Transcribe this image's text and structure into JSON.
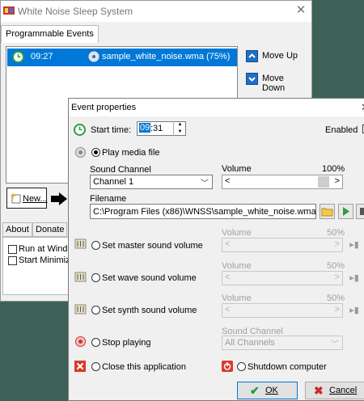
{
  "main": {
    "title": "White Noise Sleep System",
    "tab": "Programmable Events",
    "events": [
      {
        "time": "09:27",
        "description": "sample_white_noise.wma (75%)"
      }
    ],
    "move_up": "Move Up",
    "move_down": "Move Down",
    "new_label": "New...",
    "bottom_tabs": [
      "About",
      "Donate"
    ],
    "options": [
      "Run at Windows",
      "Start Minimized"
    ]
  },
  "dialog": {
    "title": "Event properties",
    "start_time_label": "Start time:",
    "start_time_hh": "09",
    "start_time_rest": ":31",
    "enabled_label": "Enabled",
    "play_media_label": "Play media file",
    "sound_channel_label": "Sound Channel",
    "sound_channel_value": "Channel 1",
    "volume_label": "Volume",
    "volume_pct": "100%",
    "volume_level": 1.0,
    "filename_label": "Filename",
    "filename_value": "C:\\Program Files (x86)\\WNSS\\sample_white_noise.wma",
    "master_label": "Set master sound volume",
    "wave_label": "Set wave sound volume",
    "synth_label": "Set synth sound volume",
    "disabled_volume_label": "Volume",
    "disabled_volume_pct": "50%",
    "stop_playing_label": "Stop playing",
    "stop_sound_channel_label": "Sound Channel",
    "stop_sound_channel_value": "All Channels",
    "close_app_label": "Close this application",
    "shutdown_label": "Shutdown computer",
    "ok_label": "OK",
    "cancel_label": "Cancel"
  },
  "colors": {
    "selection": "#0078d7",
    "desktop": "#3d6157"
  }
}
